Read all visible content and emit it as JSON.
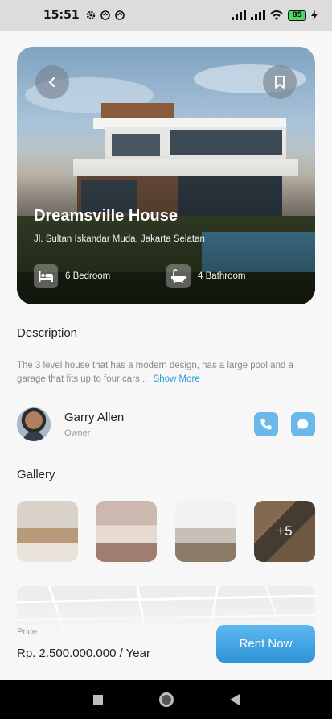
{
  "status_bar": {
    "time": "15:51",
    "battery": "85"
  },
  "property": {
    "name": "Dreamsville House",
    "address": "Jl. Sultan Iskandar Muda, Jakarta Selatan",
    "features": {
      "bedroom": "6 Bedroom",
      "bathroom": "4 Bathroom"
    }
  },
  "description": {
    "title": "Description",
    "text": "The 3 level house that has a modern design, has a large pool and a garage that fits up to four cars ..",
    "show_more": "Show More"
  },
  "owner": {
    "name": "Garry Allen",
    "role": "Owner"
  },
  "gallery": {
    "title": "Gallery",
    "more_count": "+5"
  },
  "price": {
    "label": "Price",
    "value": "Rp. 2.500.000.000 / Year"
  },
  "actions": {
    "rent_label": "Rent Now"
  },
  "icons": {
    "back": "chevron-left-icon",
    "bookmark": "bookmark-icon",
    "bed": "bed-icon",
    "bath": "bathtub-icon",
    "call": "phone-icon",
    "chat": "chat-bubble-icon"
  },
  "colors": {
    "accent": "#2f93d8",
    "accent_light": "#6bb9ea"
  }
}
